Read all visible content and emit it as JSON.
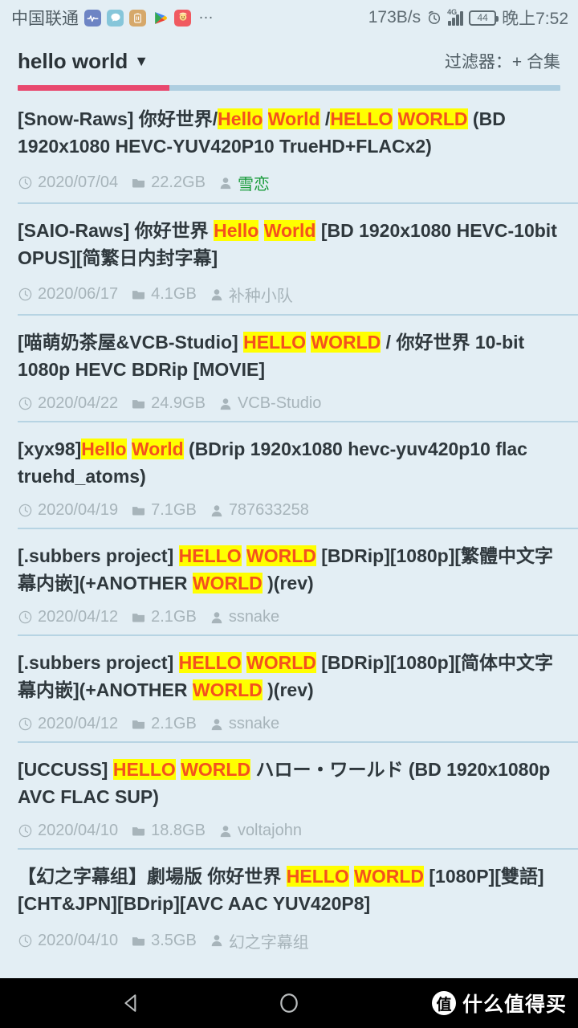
{
  "statusbar": {
    "carrier": "中国联通",
    "notification_icons": [
      "health-icon",
      "chat-icon",
      "battery-app-icon",
      "google-play-icon",
      "game-icon"
    ],
    "overflow": "…",
    "network_speed": "173B/s",
    "alarm_icon": "alarm-clock-icon",
    "network_type": "4G",
    "signal_icon": "signal-bars-icon",
    "battery_level": "44",
    "time": "晚上7:52"
  },
  "header": {
    "title": "hello world",
    "caret": "▼",
    "filter_label": "过滤器：+ 合集",
    "progress_percent": 28,
    "accent_color": "#e8486e",
    "track_color": "#aecee0"
  },
  "colors": {
    "page_background": "#e3eef4",
    "highlight_background": "#ffff00",
    "highlight_text": "#f4511e",
    "uploader_green": "#1a9c3c",
    "meta_gray": "#a7b4ba"
  },
  "list": {
    "items": [
      {
        "title_parts": [
          {
            "t": "[Snow-Raws] 你好世界/",
            "h": false
          },
          {
            "t": "Hello",
            "h": true
          },
          {
            "t": "  ",
            "h": false
          },
          {
            "t": "World",
            "h": true
          },
          {
            "t": " /",
            "h": false
          },
          {
            "t": "HELLO",
            "h": true
          },
          {
            "t": "  ",
            "h": false
          },
          {
            "t": "WORLD",
            "h": true
          },
          {
            "t": "  (BD 1920x1080 HEVC-YUV420P10 TrueHD+FLACx2)",
            "h": false
          }
        ],
        "date": "2020/07/04",
        "size": "22.2GB",
        "uploader": "雪恋",
        "uploader_green": true
      },
      {
        "title_parts": [
          {
            "t": "[SAIO-Raws] 你好世界 ",
            "h": false
          },
          {
            "t": "Hello",
            "h": true
          },
          {
            "t": "  ",
            "h": false
          },
          {
            "t": "World",
            "h": true
          },
          {
            "t": "  [BD 1920x1080 HEVC-10bit OPUS][简繁日内封字幕]",
            "h": false
          }
        ],
        "date": "2020/06/17",
        "size": "4.1GB",
        "uploader": "补种小队",
        "uploader_green": false
      },
      {
        "title_parts": [
          {
            "t": "[喵萌奶茶屋&VCB-Studio] ",
            "h": false
          },
          {
            "t": "HELLO",
            "h": true
          },
          {
            "t": "  ",
            "h": false
          },
          {
            "t": "WORLD",
            "h": true
          },
          {
            "t": "  / 你好世界 10-bit 1080p HEVC BDRip [MOVIE]",
            "h": false
          }
        ],
        "date": "2020/04/22",
        "size": "24.9GB",
        "uploader": "VCB-Studio",
        "uploader_green": false
      },
      {
        "title_parts": [
          {
            "t": "[xyx98]",
            "h": false
          },
          {
            "t": "Hello",
            "h": true
          },
          {
            "t": "  ",
            "h": false
          },
          {
            "t": "World",
            "h": true
          },
          {
            "t": "  (BDrip 1920x1080 hevc-yuv420p10 flac truehd_atoms)",
            "h": false
          }
        ],
        "date": "2020/04/19",
        "size": "7.1GB",
        "uploader": "787633258",
        "uploader_green": false
      },
      {
        "title_parts": [
          {
            "t": "[.subbers project] ",
            "h": false
          },
          {
            "t": "HELLO",
            "h": true
          },
          {
            "t": "  ",
            "h": false
          },
          {
            "t": "WORLD",
            "h": true
          },
          {
            "t": "  [BDRip][1080p][繁體中文字幕内嵌](+ANOTHER ",
            "h": false
          },
          {
            "t": "WORLD",
            "h": true
          },
          {
            "t": " )(rev)",
            "h": false
          }
        ],
        "date": "2020/04/12",
        "size": "2.1GB",
        "uploader": "ssnake",
        "uploader_green": false
      },
      {
        "title_parts": [
          {
            "t": "[.subbers project] ",
            "h": false
          },
          {
            "t": "HELLO",
            "h": true
          },
          {
            "t": "  ",
            "h": false
          },
          {
            "t": "WORLD",
            "h": true
          },
          {
            "t": "  [BDRip][1080p][简体中文字幕内嵌](+ANOTHER ",
            "h": false
          },
          {
            "t": "WORLD",
            "h": true
          },
          {
            "t": " )(rev)",
            "h": false
          }
        ],
        "date": "2020/04/12",
        "size": "2.1GB",
        "uploader": "ssnake",
        "uploader_green": false
      },
      {
        "title_parts": [
          {
            "t": "[UCCUSS] ",
            "h": false
          },
          {
            "t": "HELLO",
            "h": true
          },
          {
            "t": "  ",
            "h": false
          },
          {
            "t": "WORLD",
            "h": true
          },
          {
            "t": "  ハロー・ワールド (BD 1920x1080p AVC FLAC SUP)",
            "h": false
          }
        ],
        "date": "2020/04/10",
        "size": "18.8GB",
        "uploader": "voltajohn",
        "uploader_green": false
      },
      {
        "title_parts": [
          {
            "t": "【幻之字幕组】劇場版 你好世界 ",
            "h": false
          },
          {
            "t": "HELLO",
            "h": true
          },
          {
            "t": "  ",
            "h": false
          },
          {
            "t": "WORLD",
            "h": true
          },
          {
            "t": "  [1080P][雙語][CHT&JPN][BDrip][AVC AAC YUV420P8]",
            "h": false
          }
        ],
        "date": "2020/04/10",
        "size": "3.5GB",
        "uploader": "幻之字幕组",
        "uploader_green": false
      }
    ]
  },
  "navbar": {
    "back_icon": "back-triangle-icon",
    "home_icon": "home-circle-icon",
    "recents_icon": "recents-square-icon",
    "watermark_badge": "值",
    "watermark_text": "什么值得买"
  }
}
